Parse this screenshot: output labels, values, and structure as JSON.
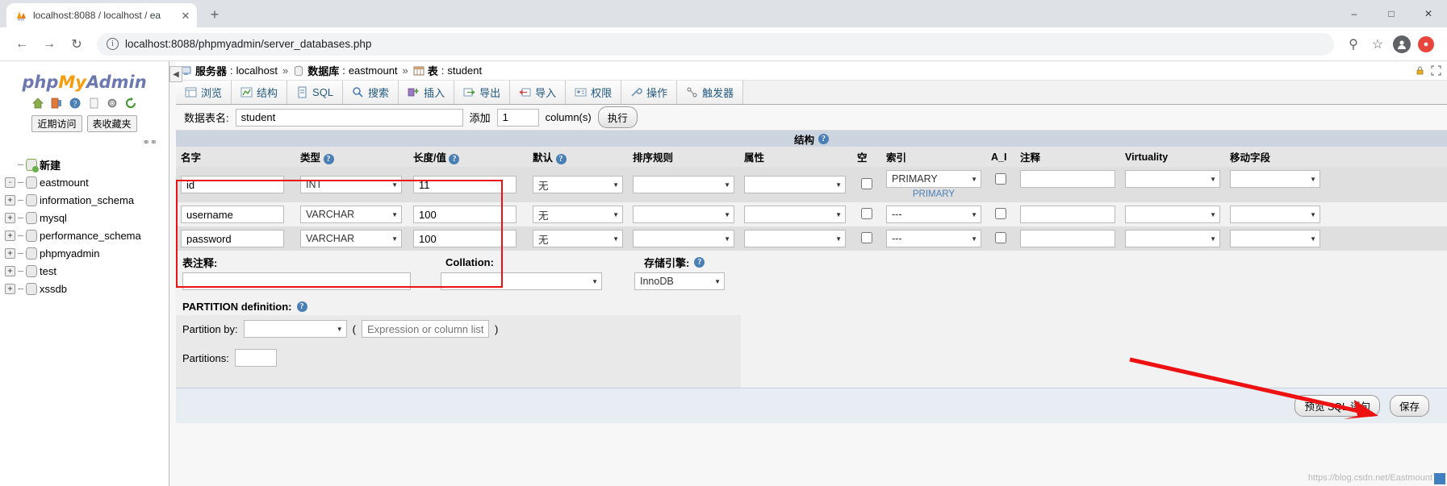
{
  "browser": {
    "tab": {
      "title": "localhost:8088 / localhost / ea",
      "favicon_icon": "phpmyadmin-favicon",
      "close_icon": "close-icon"
    },
    "new_tab_icon": "plus-icon",
    "window_controls": {
      "minimize": "minimize-icon",
      "maximize": "maximize-icon",
      "close": "close-icon"
    },
    "nav": {
      "back_icon": "back-arrow-icon",
      "forward_icon": "forward-arrow-icon",
      "reload_icon": "reload-icon"
    },
    "url": "localhost:8088/phpmyadmin/server_databases.php",
    "url_info_icon": "info-circle-icon",
    "omnibox_icons": [
      "key-icon",
      "star-icon",
      "profile-icon",
      "extension-icon"
    ]
  },
  "sidebar": {
    "logo": {
      "php": "php",
      "my": "My",
      "admin": "Admin"
    },
    "quick_icons": [
      "home-icon",
      "logout-icon",
      "help-icon",
      "docs-icon",
      "settings-icon",
      "reload-icon"
    ],
    "chips": [
      {
        "label": "近期访问"
      },
      {
        "label": "表收藏夹"
      }
    ],
    "pin_icon": "pin-icon",
    "databases": [
      {
        "label": "新建",
        "expander": "",
        "is_new": true
      },
      {
        "label": "eastmount",
        "expander": "-",
        "is_new": false
      },
      {
        "label": "information_schema",
        "expander": "+",
        "is_new": false
      },
      {
        "label": "mysql",
        "expander": "+",
        "is_new": false
      },
      {
        "label": "performance_schema",
        "expander": "+",
        "is_new": false
      },
      {
        "label": "phpmyadmin",
        "expander": "+",
        "is_new": false
      },
      {
        "label": "test",
        "expander": "+",
        "is_new": false
      },
      {
        "label": "xssdb",
        "expander": "+",
        "is_new": false
      }
    ]
  },
  "breadcrumb": {
    "collapse_icon": "collapse-arrow-icon",
    "server_label": "服务器",
    "server_value": "localhost",
    "database_label": "数据库",
    "database_value": "eastmount",
    "table_label": "表",
    "table_value": "student",
    "separator": "»",
    "right_icons": [
      "lock-icon",
      "fullscreen-icon"
    ]
  },
  "nav_tabs": [
    {
      "label": "浏览",
      "icon": "browse-icon"
    },
    {
      "label": "结构",
      "icon": "structure-icon"
    },
    {
      "label": "SQL",
      "icon": "sql-icon"
    },
    {
      "label": "搜索",
      "icon": "search-icon"
    },
    {
      "label": "插入",
      "icon": "insert-icon"
    },
    {
      "label": "导出",
      "icon": "export-icon"
    },
    {
      "label": "导入",
      "icon": "import-icon"
    },
    {
      "label": "权限",
      "icon": "privileges-icon"
    },
    {
      "label": "操作",
      "icon": "operations-icon"
    },
    {
      "label": "触发器",
      "icon": "triggers-icon"
    }
  ],
  "form_bar": {
    "table_name_label": "数据表名:",
    "table_name_value": "student",
    "add_label": "添加",
    "add_count": "1",
    "columns_label": "column(s)",
    "go_button": "执行"
  },
  "structure": {
    "section_title": "结构",
    "help_icon": "help-icon",
    "headers": [
      {
        "label": "名字",
        "help": false
      },
      {
        "label": "类型",
        "help": true
      },
      {
        "label": "长度/值",
        "help": true
      },
      {
        "label": "默认",
        "help": true
      },
      {
        "label": "排序规则",
        "help": false
      },
      {
        "label": "属性",
        "help": false
      },
      {
        "label": "空",
        "help": false
      },
      {
        "label": "索引",
        "help": false
      },
      {
        "label": "A_I",
        "help": false
      },
      {
        "label": "注释",
        "help": false
      },
      {
        "label": "Virtuality",
        "help": false
      },
      {
        "label": "移动字段",
        "help": false
      }
    ],
    "rows": [
      {
        "name": "id",
        "type": "INT",
        "length": "11",
        "default": "无",
        "collation": "",
        "attributes": "",
        "null": false,
        "index": "PRIMARY",
        "index_note": "PRIMARY",
        "auto_increment": false,
        "comment": "",
        "virtuality": ""
      },
      {
        "name": "username",
        "type": "VARCHAR",
        "length": "100",
        "default": "无",
        "collation": "",
        "attributes": "",
        "null": false,
        "index": "---",
        "index_note": "",
        "auto_increment": false,
        "comment": "",
        "virtuality": ""
      },
      {
        "name": "password",
        "type": "VARCHAR",
        "length": "100",
        "default": "无",
        "collation": "",
        "attributes": "",
        "null": false,
        "index": "---",
        "index_note": "",
        "auto_increment": false,
        "comment": "",
        "virtuality": ""
      }
    ]
  },
  "table_options": {
    "comment_label": "表注释:",
    "comment_value": "",
    "collation_label": "Collation:",
    "collation_value": "",
    "engine_label": "存储引擎:",
    "engine_value": "InnoDB",
    "engine_help_icon": "help-icon"
  },
  "partition": {
    "title": "PARTITION definition:",
    "help_icon": "help-icon",
    "partition_by_label": "Partition by:",
    "partition_by_value": "",
    "paren_open": "(",
    "paren_close": ")",
    "expression_placeholder": "Expression or column list",
    "expression_value": "",
    "partitions_label": "Partitions:",
    "partitions_value": ""
  },
  "footer": {
    "preview_sql_button": "预览 SQL 语句",
    "save_button": "保存",
    "arrow_annotation": "red-arrow-icon"
  },
  "watermark": "https://blog.csdn.net/Eastmount",
  "colors": {
    "accent_blue": "#4a7fb5",
    "annotation_red": "#ee1111",
    "logo_orange": "#f89c0e",
    "logo_blue": "#6c78af",
    "header_grey": "#ccd4df",
    "footer_blue": "#e8ecf3"
  }
}
